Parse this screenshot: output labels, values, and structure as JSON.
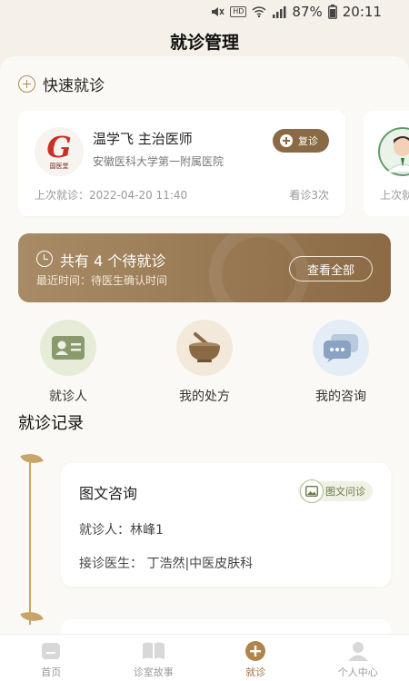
{
  "status_bar": {
    "battery": "87%",
    "time": "20:11",
    "hd": "HD"
  },
  "page_title": "就诊管理",
  "quick": {
    "title": "快速就诊",
    "doctors": [
      {
        "name": "温学飞 主治医师",
        "hospital": "安徽医科大学第一附属医院",
        "revisit_label": "复诊",
        "last_visit": "上次就诊：2022-04-20 11:40",
        "visit_count": "看诊3次",
        "logo_text": "国医堂"
      },
      {
        "last_visit": "上次就"
      }
    ]
  },
  "pending": {
    "title": "共有 4 个待就诊",
    "subtitle": "最近时间：待医生确认时间",
    "view_all": "查看全部"
  },
  "shortcuts": [
    {
      "label": "就诊人",
      "icon": "id-card-icon",
      "color": "#e7ecd9"
    },
    {
      "label": "我的处方",
      "icon": "mortar-icon",
      "color": "#f3e9da"
    },
    {
      "label": "我的咨询",
      "icon": "chat-icon",
      "color": "#e4ecf6"
    }
  ],
  "records": {
    "title": "就诊记录",
    "items": [
      {
        "type": "图文咨询",
        "tag": "图文问诊",
        "patient": "就诊人：林峰1",
        "doctor": "接诊医生： 丁浩然|中医皮肤科"
      }
    ]
  },
  "nav": {
    "items": [
      {
        "label": "首页",
        "icon": "home-icon"
      },
      {
        "label": "诊室故事",
        "icon": "book-icon"
      },
      {
        "label": "就诊",
        "icon": "plus-icon"
      },
      {
        "label": "个人中心",
        "icon": "user-icon"
      }
    ],
    "active_index": 2,
    "accent": "#9a7440"
  }
}
